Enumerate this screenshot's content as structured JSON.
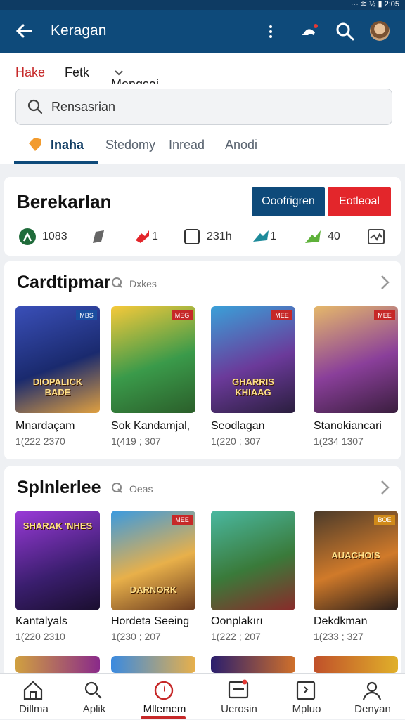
{
  "status": {
    "icons": "⋯  ≋  ½  ▮",
    "time": "2:05"
  },
  "appbar": {
    "title": "Keragan"
  },
  "filters": [
    "Hake",
    "Fetk",
    "Mengsai"
  ],
  "search": {
    "placeholder": "Rensasrian"
  },
  "tabs": [
    "Inaha",
    "Stedomy",
    "Inread",
    "Anodi"
  ],
  "header_card": {
    "title": "Berekarlan",
    "primary_button": "Ooofrigren",
    "secondary_button": "Eotleoal",
    "stats": [
      "1083",
      "",
      "1",
      "231h",
      "1",
      "40",
      ""
    ]
  },
  "section1": {
    "title": "Cardtipmar",
    "subtitle": "Dxkes",
    "games": [
      {
        "name": "Mnardaçam",
        "meta": "1(222 2370",
        "art": "DIOPALICK BADE",
        "badge": "MBS"
      },
      {
        "name": "Sok Kandamjal,",
        "meta": "1(419 ; 307",
        "art": "",
        "badge": "MEG"
      },
      {
        "name": "Seodlagan",
        "meta": "1(220 ; 307",
        "art": "GHARRIS KHIAAG",
        "badge": "MEE"
      },
      {
        "name": "Stanokiancari",
        "meta": "1(234 1307",
        "art": "",
        "badge": "MEE"
      }
    ]
  },
  "section2": {
    "title": "Splnlerlee",
    "subtitle": "Oeas",
    "games": [
      {
        "name": "Kantalyals",
        "meta": "1(220 2310",
        "art": "SHARAK 'NHES",
        "badge": ""
      },
      {
        "name": "Hordeta Seeing",
        "meta": "1(230 ; 207",
        "art": "DARNORK",
        "badge": "MEE"
      },
      {
        "name": "Oonplakırı",
        "meta": "1(222 ; 207",
        "art": "",
        "badge": ""
      },
      {
        "name": "Dekdkman",
        "meta": "1(233 ; 327",
        "art": "AUACHOIS",
        "badge": "BOE"
      }
    ]
  },
  "bottom_nav": [
    "Dillma",
    "Aplik",
    "Mllemem",
    "Uerosin",
    "Mpluo",
    "Denyan"
  ],
  "colors": {
    "primary": "#0e4a7a",
    "accent": "#c62828",
    "secondary_btn": "#e3262b"
  }
}
